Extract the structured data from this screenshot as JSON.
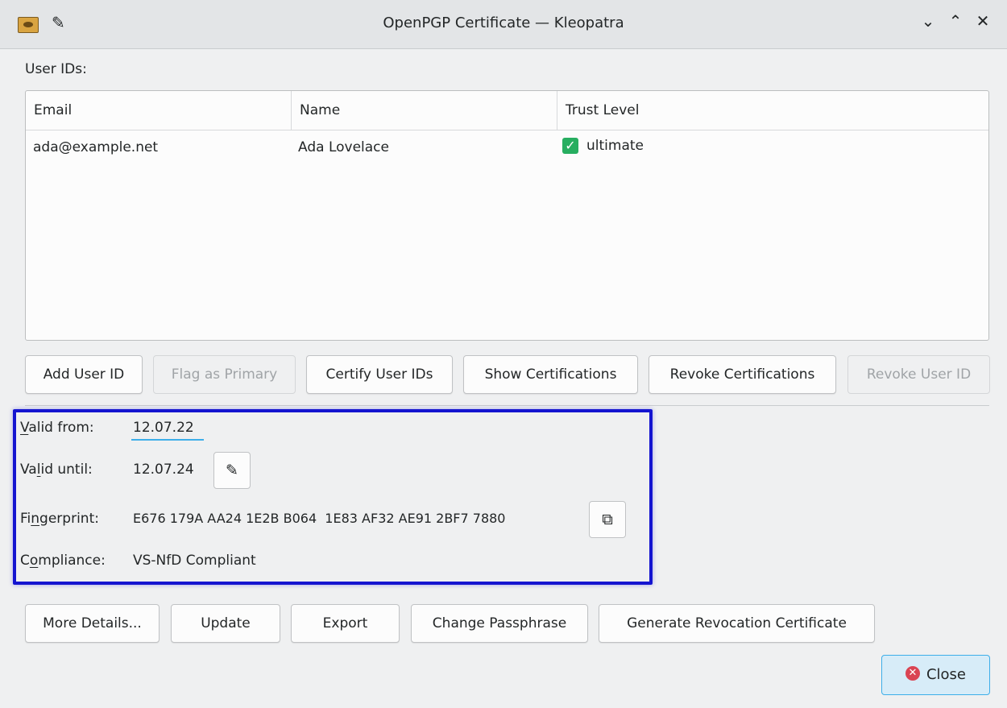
{
  "window": {
    "title": "OpenPGP Certificate — Kleopatra",
    "minimize_glyph": "⌄",
    "maximize_glyph": "⌃",
    "close_glyph": "✕"
  },
  "user_ids": {
    "section_label": "User IDs:",
    "columns": [
      "Email",
      "Name",
      "Trust Level"
    ],
    "rows": [
      {
        "email": "ada@example.net",
        "name": "Ada Lovelace",
        "trust": "ultimate"
      }
    ],
    "buttons": {
      "add": "Add User ID",
      "flag_primary": "Flag as Primary",
      "certify": "Certify User IDs",
      "show_certs": "Show Certifications",
      "revoke_certs": "Revoke Certifications",
      "revoke_uid": "Revoke User ID"
    }
  },
  "details": {
    "valid_from_prefix": "V",
    "valid_from_rest": "alid from:",
    "valid_from_value": "12.07.22",
    "valid_until_prefix": "Va",
    "valid_until_ul": "l",
    "valid_until_rest": "id until:",
    "valid_until_value": "12.07.24",
    "fingerprint_prefix": "Fi",
    "fingerprint_ul": "n",
    "fingerprint_rest": "gerprint:",
    "fingerprint_value": "E676 179A AA24 1E2B B064  1E83 AF32 AE91 2BF7 7880",
    "compliance_prefix": "C",
    "compliance_ul": "o",
    "compliance_rest": "mpliance:",
    "compliance_value": "VS-NfD Compliant"
  },
  "actions": {
    "more_details": "More Details...",
    "update": "Update",
    "export": "Export",
    "change_passphrase": "Change Passphrase",
    "generate_revocation": "Generate Revocation Certificate",
    "close": "Close"
  },
  "colors": {
    "accent": "#3daee9",
    "highlight_frame": "#1414d0",
    "trust_ok": "#27ae60",
    "close_icon": "#da4453"
  }
}
